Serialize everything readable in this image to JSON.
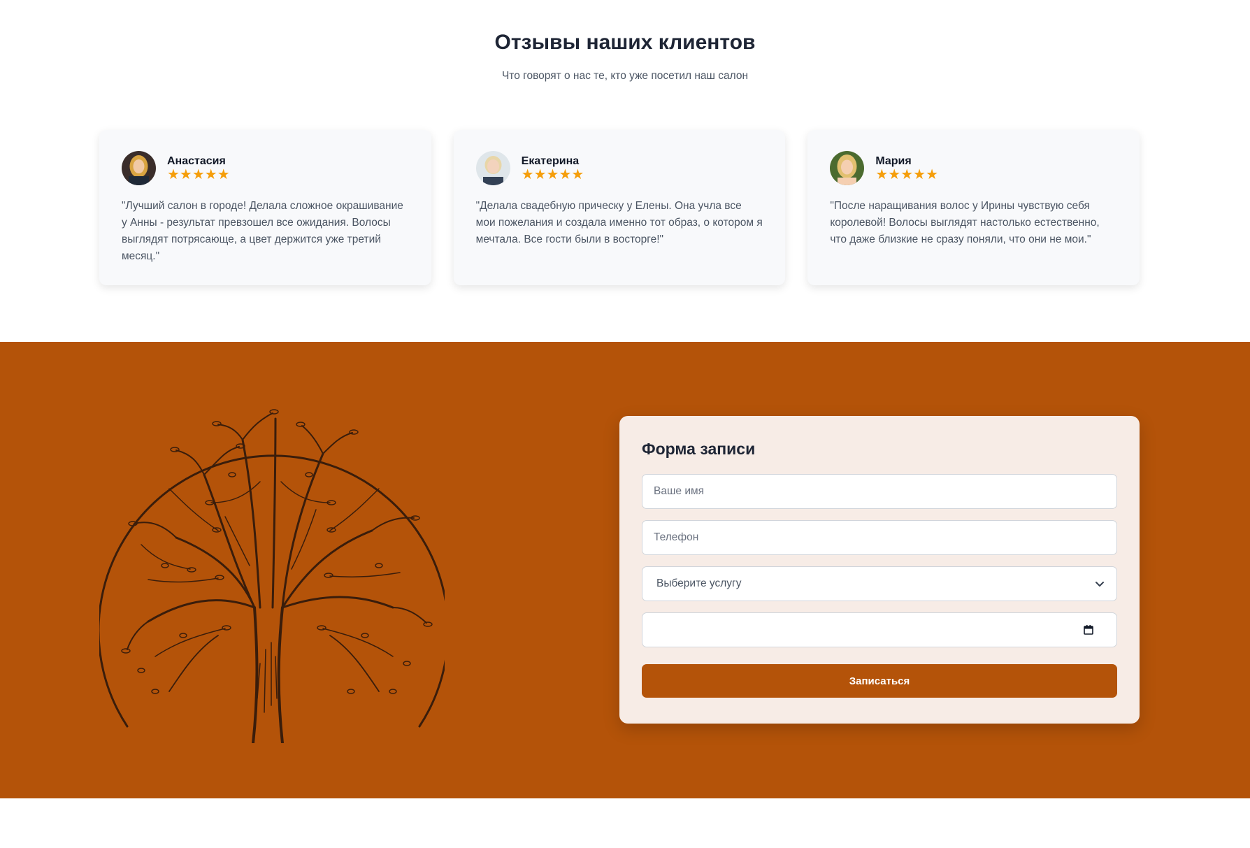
{
  "reviews": {
    "title": "Отзывы наших клиентов",
    "subtitle": "Что говорят о нас те, кто уже посетил наш салон",
    "items": [
      {
        "name": "Анастасия",
        "rating": 5,
        "stars": "★★★★★",
        "text": "\"Лучший салон в городе! Делала сложное окрашивание у Анны - результат превзошел все ожидания. Волосы выглядят потрясающе, а цвет держится уже третий месяц.\""
      },
      {
        "name": "Екатерина",
        "rating": 5,
        "stars": "★★★★★",
        "text": "\"Делала свадебную прическу у Елены. Она учла все мои пожелания и создала именно тот образ, о котором я мечтала. Все гости были в восторге!\""
      },
      {
        "name": "Мария",
        "rating": 5,
        "stars": "★★★★★",
        "text": "\"После наращивания волос у Ирины чувствую себя королевой! Волосы выглядят настолько естественно, что даже близкие не сразу поняли, что они не мои.\""
      }
    ]
  },
  "booking": {
    "form_title": "Форма записи",
    "name_placeholder": "Ваше имя",
    "phone_placeholder": "Телефон",
    "service_select_value": "Выберите услугу",
    "date_value": "",
    "submit_label": "Записаться"
  },
  "colors": {
    "accent": "#b45309",
    "form_bg": "#f7ece6",
    "star": "#f59e0b",
    "card_bg": "#f8f9fb"
  },
  "icons": {
    "tree": "tree-illustration",
    "chevron": "chevron-down-icon",
    "calendar": "calendar-icon"
  }
}
